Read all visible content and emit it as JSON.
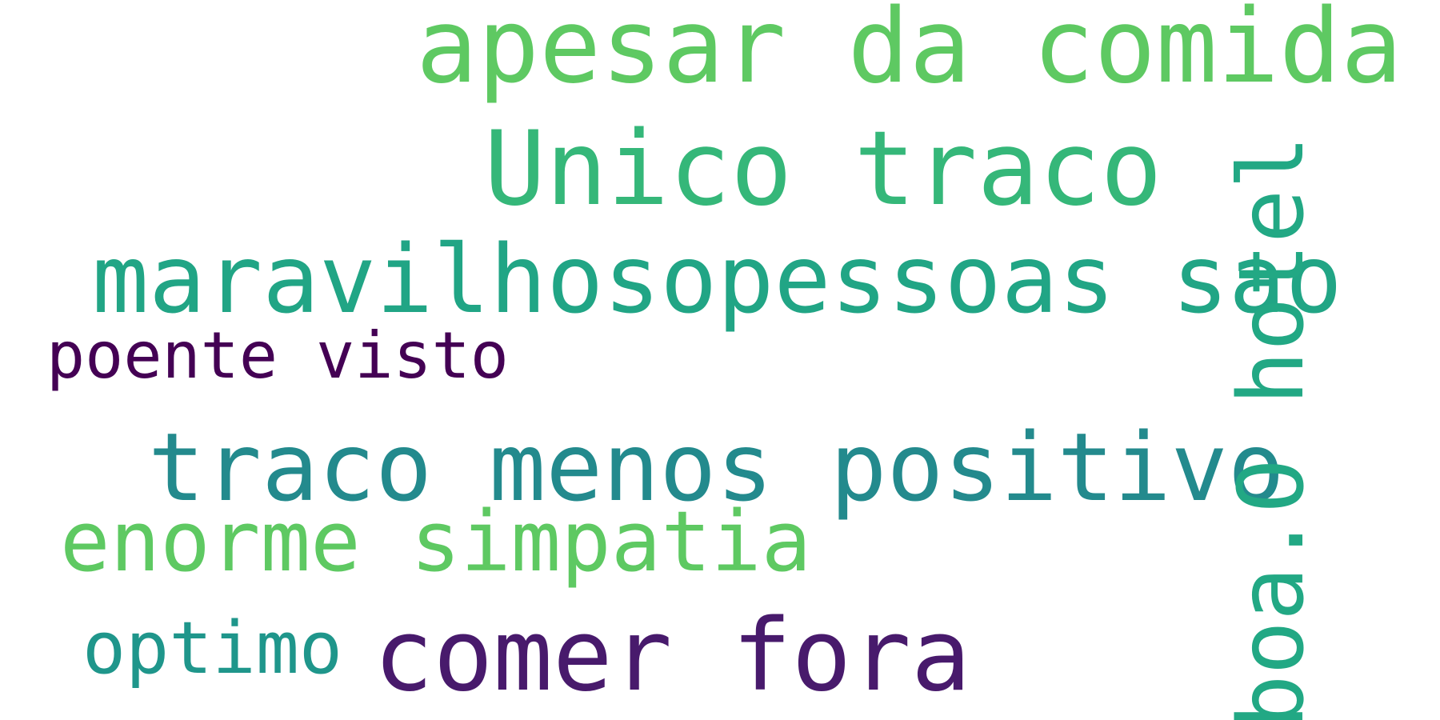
{
  "words": [
    {
      "text": "apesar da comida",
      "color": "#5ec962"
    },
    {
      "text": "Unico traco",
      "color": "#35b779"
    },
    {
      "text": "maravilhosopessoas sao",
      "color": "#21a585"
    },
    {
      "text": "poente visto",
      "color": "#440154"
    },
    {
      "text": "traco menos positivo",
      "color": "#238a8d"
    },
    {
      "text": "enorme simpatia",
      "color": "#5ec962"
    },
    {
      "text": "optimo",
      "color": "#1f968b"
    },
    {
      "text": "comer fora",
      "color": "#481a6c"
    },
    {
      "text": "boa.O hotel",
      "color": "#22a884"
    }
  ]
}
